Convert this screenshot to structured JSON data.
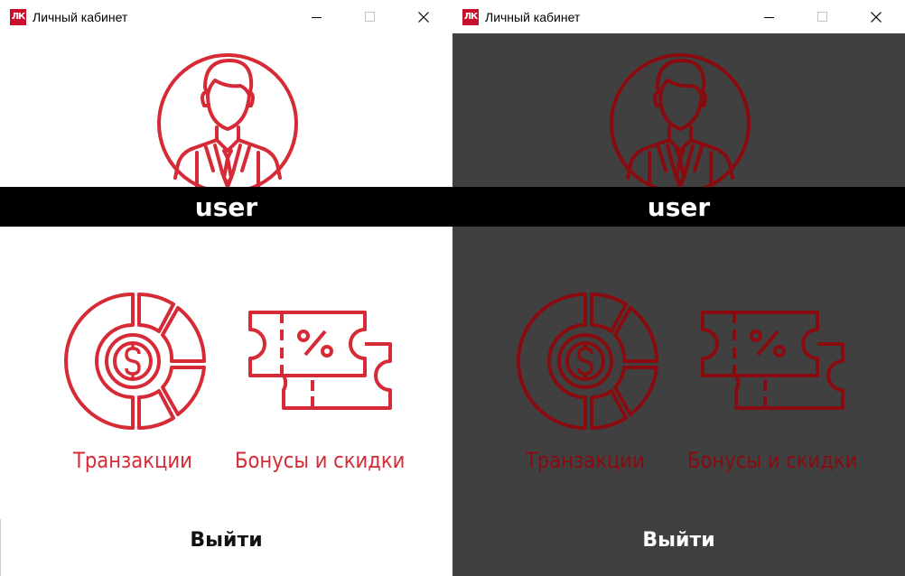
{
  "windows": [
    {
      "theme": "light",
      "title": "Личный кабинет",
      "app_icon_text": "ЛК",
      "username": "user",
      "tiles": [
        {
          "label": "Транзакции",
          "icon": "transactions-icon"
        },
        {
          "label": "Бонусы и скидки",
          "icon": "coupon-icon"
        }
      ],
      "logout_label": "Выйти",
      "colors": {
        "background": "#ffffff",
        "accent": "#d62b36",
        "band": "#000000",
        "logout_text": "#111111"
      }
    },
    {
      "theme": "dark",
      "title": "Личный кабинет",
      "app_icon_text": "ЛК",
      "username": "user",
      "tiles": [
        {
          "label": "Транзакции",
          "icon": "transactions-icon"
        },
        {
          "label": "Бонусы и скидки",
          "icon": "coupon-icon"
        }
      ],
      "logout_label": "Выйти",
      "colors": {
        "background": "#404040",
        "accent": "#8a0b0f",
        "band": "#000000",
        "logout_text": "#ffffff"
      }
    }
  ]
}
